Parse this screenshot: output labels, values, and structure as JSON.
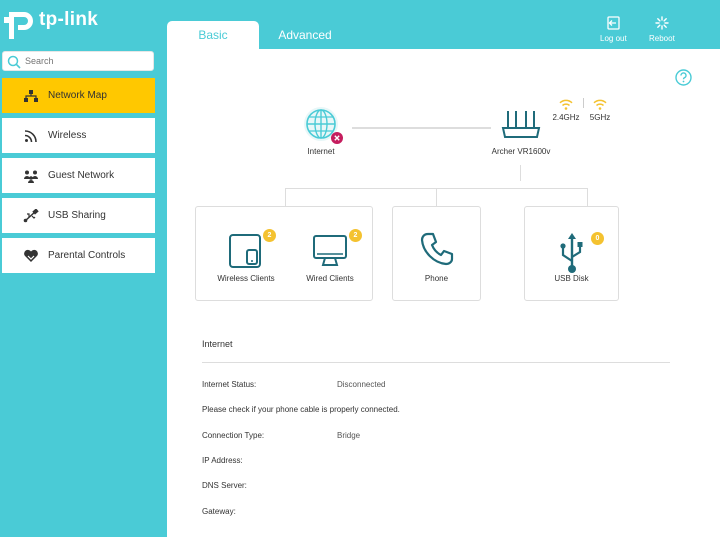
{
  "brand": {
    "logo_text": "tp-link",
    "accent": "#4acbd6",
    "active_color": "#ffc800"
  },
  "tabs": [
    {
      "label": "Basic",
      "active": true
    },
    {
      "label": "Advanced",
      "active": false
    }
  ],
  "header_buttons": {
    "logout": "Log out",
    "reboot": "Reboot"
  },
  "search": {
    "placeholder": "Search"
  },
  "sidebar": {
    "items": [
      {
        "label": "Network Map",
        "icon": "network-map-icon",
        "active": true
      },
      {
        "label": "Wireless",
        "icon": "wifi-icon",
        "active": false
      },
      {
        "label": "Guest Network",
        "icon": "guest-icon",
        "active": false
      },
      {
        "label": "USB Sharing",
        "icon": "usb-sharing-icon",
        "active": false
      },
      {
        "label": "Parental Controls",
        "icon": "heart-icon",
        "active": false
      }
    ]
  },
  "map": {
    "internet_label": "Internet",
    "router_label": "Archer VR1600v",
    "band_24": "2.4GHz",
    "band_5": "5GHz",
    "devices": [
      {
        "label": "Wireless Clients",
        "count": "2"
      },
      {
        "label": "Wired Clients",
        "count": "2"
      },
      {
        "label": "Phone"
      },
      {
        "label": "USB Disk",
        "count": "0"
      }
    ]
  },
  "info": {
    "title": "Internet",
    "status_label": "Internet Status:",
    "status_value": "Disconnected",
    "cable_message": "Please check if your phone cable is properly connected.",
    "conn_type_label": "Connection Type:",
    "conn_type_value": "Bridge",
    "ip_label": "IP Address:",
    "dns_label": "DNS Server:",
    "gateway_label": "Gateway:"
  }
}
